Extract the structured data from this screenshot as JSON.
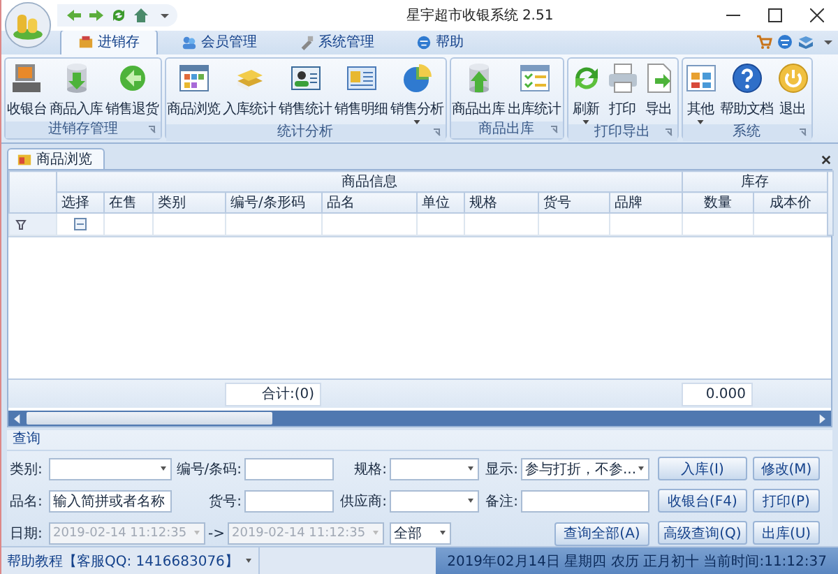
{
  "window": {
    "title": "星宇超市收银系统 2.51"
  },
  "tabs": [
    {
      "label": "进销存",
      "selected": true
    },
    {
      "label": "会员管理",
      "selected": false
    },
    {
      "label": "系统管理",
      "selected": false
    },
    {
      "label": "帮助",
      "selected": false
    }
  ],
  "ribbon_groups": [
    {
      "label": "进销存管理",
      "buttons": [
        {
          "label": "收银台",
          "dropdown": false
        },
        {
          "label": "商品入库",
          "dropdown": false
        },
        {
          "label": "销售退货",
          "dropdown": false
        }
      ]
    },
    {
      "label": "统计分析",
      "buttons": [
        {
          "label": "商品浏览",
          "dropdown": false
        },
        {
          "label": "入库统计",
          "dropdown": false
        },
        {
          "label": "销售统计",
          "dropdown": false
        },
        {
          "label": "销售明细",
          "dropdown": false
        },
        {
          "label": "销售分析",
          "dropdown": true
        }
      ]
    },
    {
      "label": "商品出库",
      "buttons": [
        {
          "label": "商品出库",
          "dropdown": false
        },
        {
          "label": "出库统计",
          "dropdown": false
        }
      ]
    },
    {
      "label": "打印导出",
      "buttons": [
        {
          "label": "刷新",
          "dropdown": true
        },
        {
          "label": "打印",
          "dropdown": false
        },
        {
          "label": "导出",
          "dropdown": false
        }
      ]
    },
    {
      "label": "系统",
      "buttons": [
        {
          "label": "其他",
          "dropdown": true
        },
        {
          "label": "帮助文档",
          "dropdown": false
        },
        {
          "label": "退出",
          "dropdown": false
        }
      ]
    }
  ],
  "document_tab": {
    "label": "商品浏览"
  },
  "grid": {
    "groups": [
      {
        "label": "商品信息",
        "columns": [
          "选择",
          "在售",
          "类别",
          "编号/条形码",
          "品名",
          "单位",
          "规格",
          "货号",
          "品牌"
        ]
      },
      {
        "label": "库存",
        "columns": [
          "数量",
          "成本价"
        ]
      }
    ],
    "filter_checked": false,
    "summary": {
      "count": "合计:(0)",
      "quantity": "0.000"
    }
  },
  "query": {
    "title": "查询",
    "rows": [
      [
        {
          "label": "类别:",
          "kind": "dropdown"
        },
        {
          "label": "编号/条码:",
          "kind": "text"
        },
        {
          "label": "规格:",
          "kind": "dropdown"
        },
        {
          "label": "显示:",
          "kind": "dropdown",
          "value": "参与打折，不参..."
        }
      ],
      [
        {
          "label": "品名:",
          "kind": "text",
          "value": "输入简拼或者名称"
        },
        {
          "label": "货号:",
          "kind": "text"
        },
        {
          "label": "供应商:",
          "kind": "dropdown"
        },
        {
          "label": "备注:",
          "kind": "text"
        }
      ]
    ],
    "date": {
      "label": "日期:",
      "from": "2019-02-14 11:12:35",
      "separator": "->",
      "to": "2019-02-14 11:12:35",
      "disabled": true,
      "range": "全部"
    },
    "query_all_button": "查询全部(A)",
    "side_buttons": [
      "入库(I)",
      "修改(M)",
      "收银台(F4)",
      "打印(P)",
      "高级查询(Q)",
      "出库(U)"
    ]
  },
  "status_bar": {
    "help": "帮助教程【客服QQ: 1416683076】",
    "datetime": "2019年02月14日 星期四 农历 正月初十 当前时间:11:12:37"
  }
}
